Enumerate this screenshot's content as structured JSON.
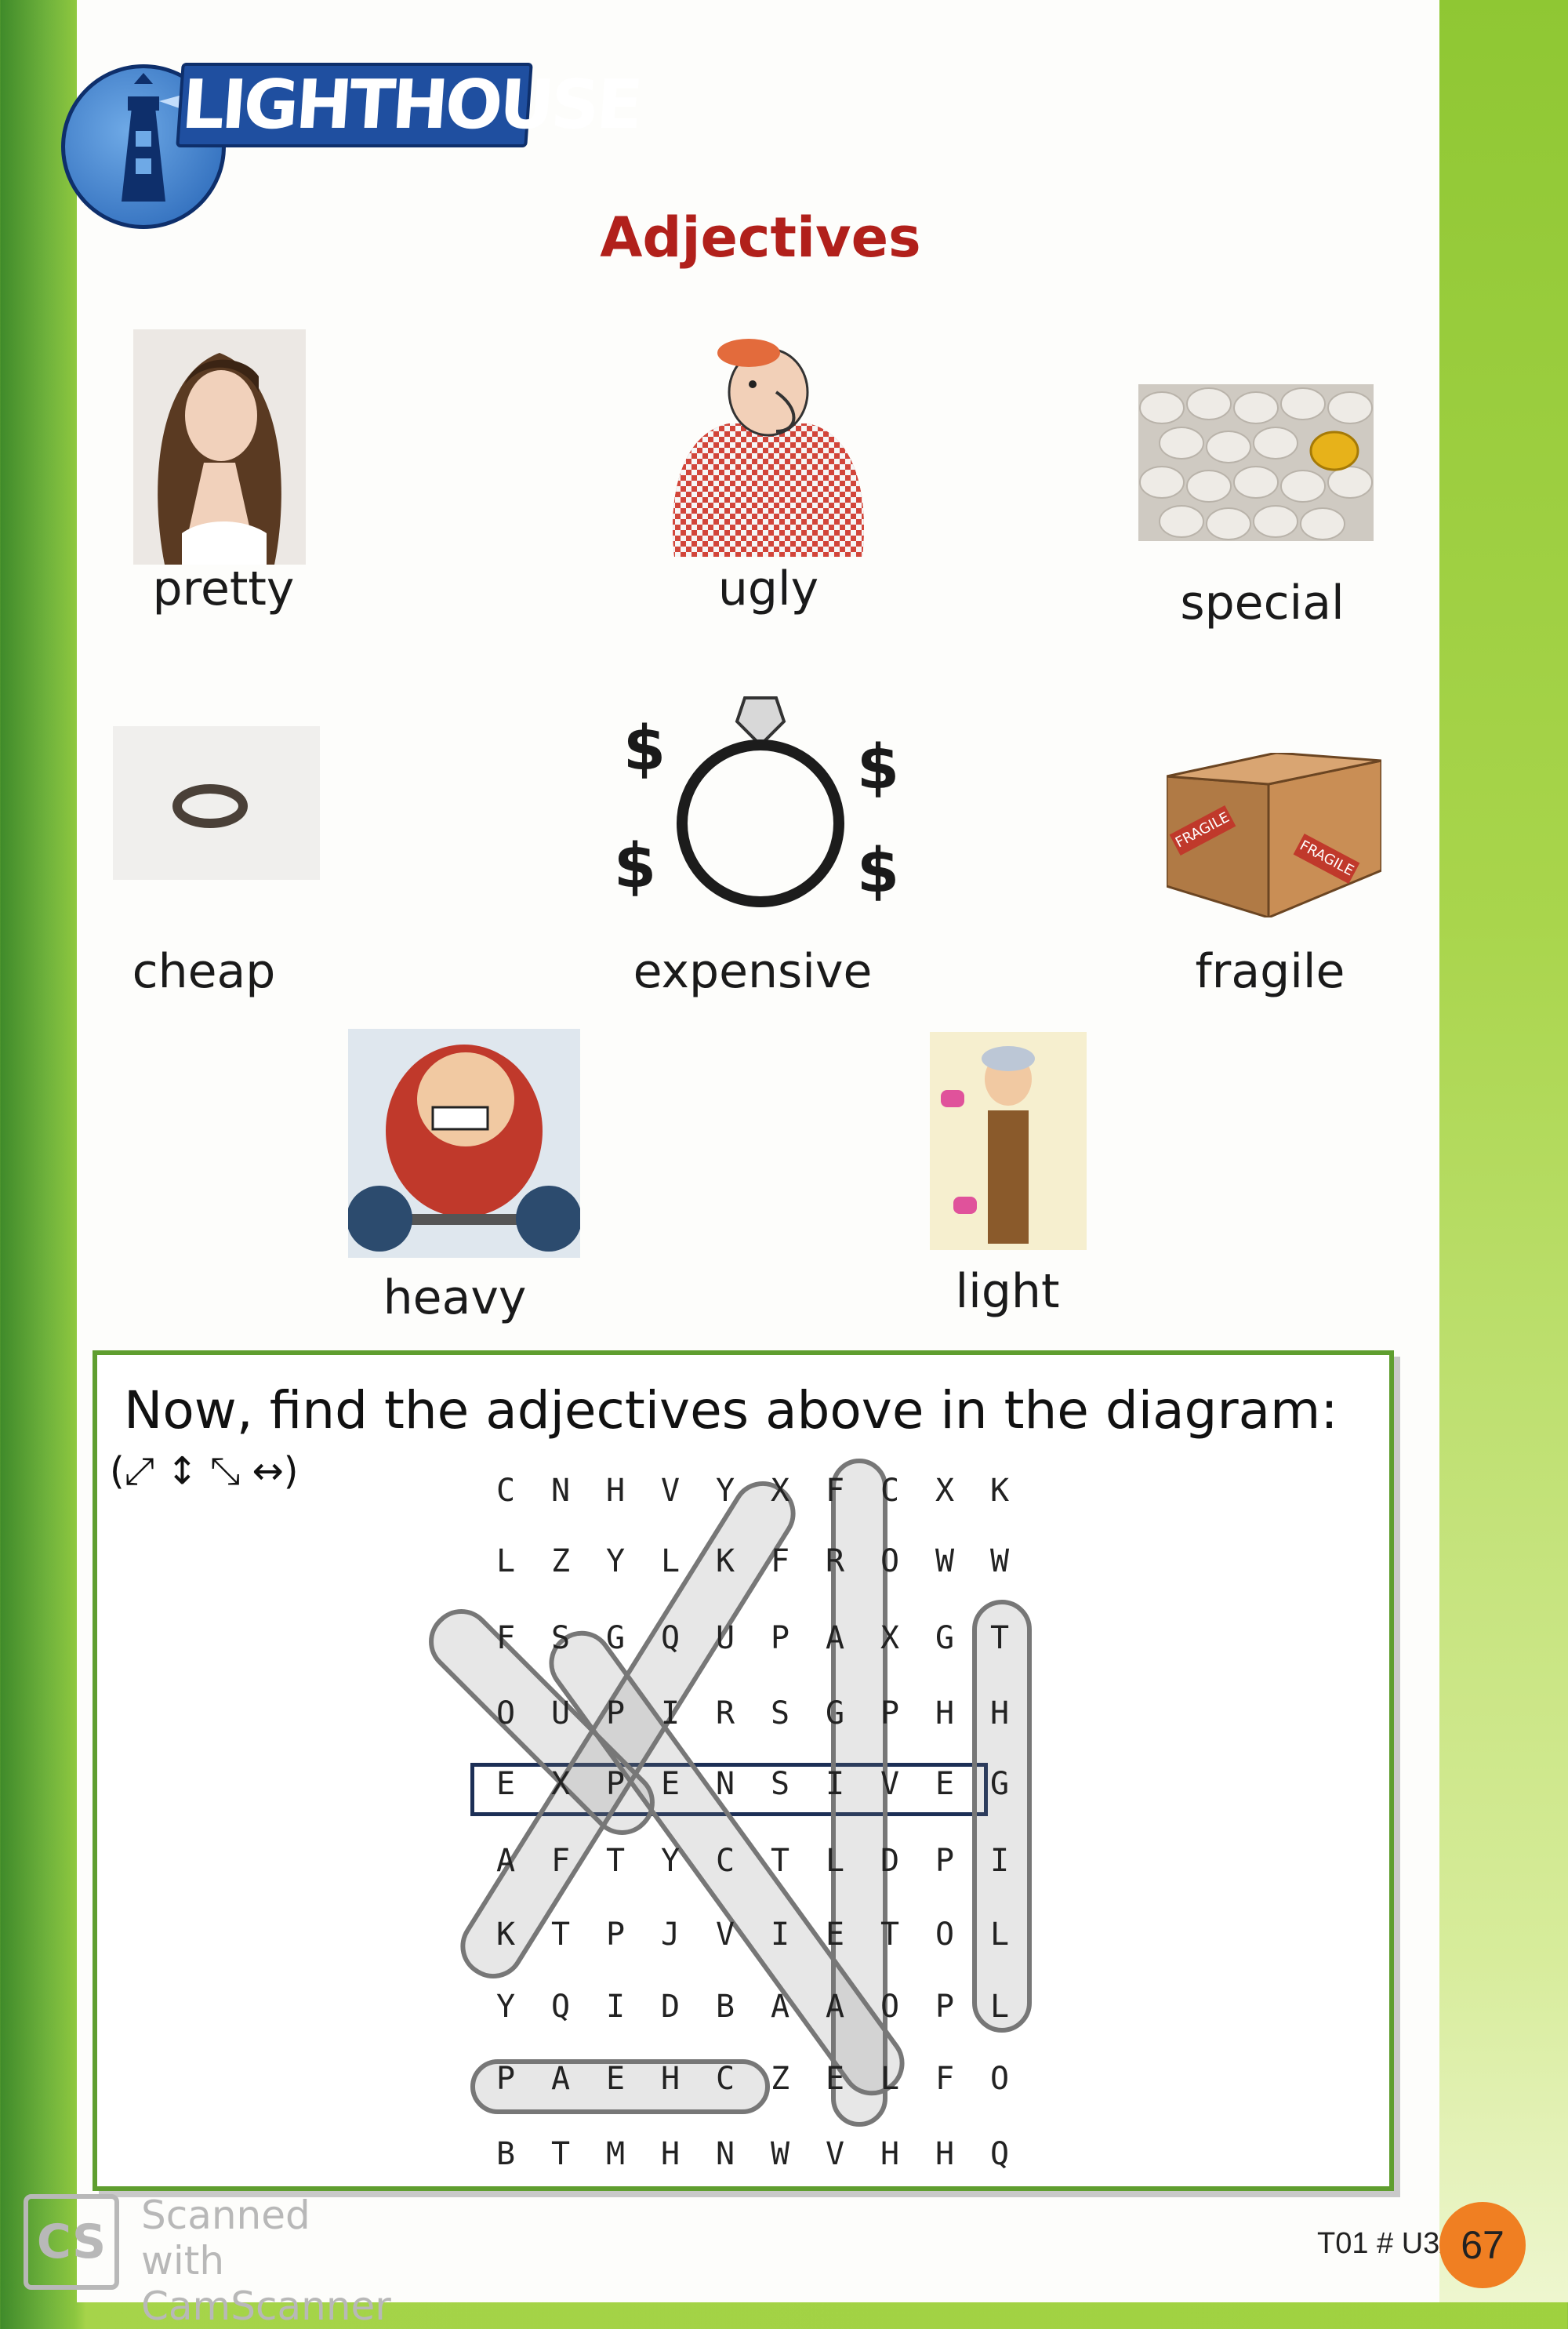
{
  "header": {
    "logo_text": "LIGHTHOUSE",
    "title": "Adjectives"
  },
  "pictures": [
    {
      "label": "pretty"
    },
    {
      "label": "ugly"
    },
    {
      "label": "special"
    },
    {
      "label": "cheap"
    },
    {
      "label": "expensive"
    },
    {
      "label": "fragile"
    },
    {
      "label": "heavy"
    },
    {
      "label": "light"
    }
  ],
  "expensive_symbols": [
    "$",
    "$",
    "$",
    "$"
  ],
  "box_labels": [
    "FRAGILE",
    "FRAGILE"
  ],
  "puzzle": {
    "instruction": "Now, find the adjectives above in the diagram:",
    "directions": "(⤢ ↕ ⤡ ↔)",
    "rows": [
      [
        "C",
        "N",
        "H",
        "V",
        "Y",
        "X",
        "F",
        "C",
        "X",
        "K"
      ],
      [
        "L",
        "Z",
        "Y",
        "L",
        "K",
        "F",
        "R",
        "O",
        "W",
        "W"
      ],
      [
        "F",
        "S",
        "G",
        "Q",
        "U",
        "P",
        "A",
        "X",
        "G",
        "T"
      ],
      [
        "O",
        "U",
        "P",
        "I",
        "R",
        "S",
        "G",
        "P",
        "H",
        "H"
      ],
      [
        "E",
        "X",
        "P",
        "E",
        "N",
        "S",
        "I",
        "V",
        "E",
        "G"
      ],
      [
        "A",
        "F",
        "T",
        "Y",
        "C",
        "T",
        "L",
        "D",
        "P",
        "I"
      ],
      [
        "K",
        "T",
        "P",
        "J",
        "V",
        "I",
        "E",
        "T",
        "O",
        "L"
      ],
      [
        "Y",
        "Q",
        "I",
        "D",
        "B",
        "A",
        "A",
        "O",
        "P",
        "L"
      ],
      [
        "P",
        "A",
        "E",
        "H",
        "C",
        "Z",
        "E",
        "L",
        "F",
        "O"
      ],
      [
        "B",
        "T",
        "M",
        "H",
        "N",
        "W",
        "V",
        "H",
        "H",
        "Q"
      ]
    ]
  },
  "footer": {
    "code": "T01 # U3A",
    "page_number": "67",
    "watermark_badge": "CS",
    "watermark_line1": "Scanned with",
    "watermark_line2": "CamScanner"
  }
}
